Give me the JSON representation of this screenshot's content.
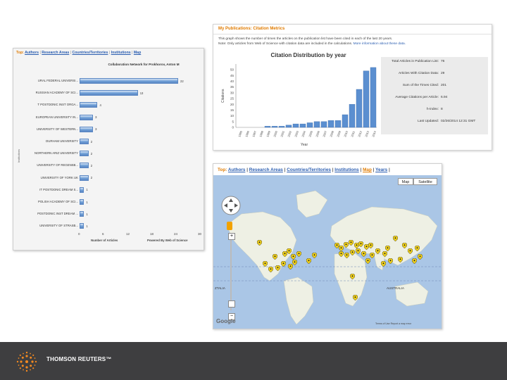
{
  "collab": {
    "nav": {
      "prefix": "Top:",
      "items": [
        "Authors",
        "Research Areas",
        "Countries/Territories",
        "Institutions",
        "Map"
      ]
    },
    "chart_title": "Collaboration Network for Prokhorov, Anton M",
    "y_axis_label": "Institutions",
    "x_label": "Number of Articles",
    "powered_by": "Powered By Web of Science",
    "chart_data": {
      "type": "bar",
      "orientation": "horizontal",
      "categories": [
        "URAL FEDERAL UNIVERSI...",
        "RUSSIAN ACADEMY OF SCI...",
        "T POSTDONIC INST ORGA...",
        "EUROPEAN UNIVERSITY IN...",
        "UNIVERSITY OF WESTERN...",
        "DURHAM UNIVERSITY",
        "NORTHERN ARIZ UNIVERSITY",
        "UNIVERSITY OF REGENSB...",
        "UNIVERSITY OF YORK UK",
        "IT POSTDONIC DREAM S...",
        "POLISH ACADEMY OF SCI...",
        "POSTDONIC INST DREAM ...",
        "UNIVERSITY OF STRASB..."
      ],
      "values": [
        22,
        13,
        4,
        3,
        3,
        2,
        2,
        2,
        2,
        1,
        1,
        1,
        1
      ],
      "value_labels": [
        "22",
        "13",
        "4",
        "3",
        "3",
        "2",
        "2",
        "2",
        "2",
        "1",
        "1",
        "1",
        "1"
      ],
      "xlim": [
        0,
        20
      ],
      "xticks": [
        "0",
        "6",
        "12",
        "18",
        "24",
        "30"
      ],
      "xlabel": "Number of Articles",
      "ylabel": "Institutions"
    }
  },
  "citation": {
    "header": "My Publications: Citation Metrics",
    "note1": "This graph shows the number of times the articles on the publication list have been cited in each of the last 20 years.",
    "note2_a": "Note: Only articles from Web of Science with citation data are included in the calculations.",
    "note2_link": "More information about these data.",
    "chart_title": "Citation Distribution by year",
    "y_axis_label": "Citations",
    "x_axis_label": "Year",
    "chart_data": {
      "type": "bar",
      "title": "Citation Distribution by year",
      "xlabel": "Year",
      "ylabel": "Citations",
      "ylim": [
        0,
        55
      ],
      "yticks": [
        "0",
        "5",
        "10",
        "15",
        "20",
        "25",
        "30",
        "35",
        "40",
        "45",
        "50"
      ],
      "categories": [
        "1995",
        "1996",
        "1997",
        "1998",
        "1999",
        "2000",
        "2001",
        "2002",
        "2003",
        "2004",
        "2005",
        "2006",
        "2007",
        "2008",
        "2009",
        "2010",
        "2011",
        "2012",
        "2013",
        "2014"
      ],
      "values": [
        0,
        0,
        0,
        0,
        1,
        1,
        1,
        2,
        3,
        3,
        4,
        5,
        5,
        6,
        6,
        11,
        20,
        33,
        49,
        52
      ]
    },
    "stats": [
      {
        "label": "Total Articles in Publication List:",
        "value": "76"
      },
      {
        "label": "Articles With Citation Data:",
        "value": "29"
      },
      {
        "label": "Sum of the Times Cited:",
        "value": "201"
      },
      {
        "label": "Average Citations per Article:",
        "value": "6.94"
      },
      {
        "label": "h-index:",
        "value": "8"
      },
      {
        "label": "Last Updated:",
        "value": "02/26/2014 12:31 GMT"
      }
    ]
  },
  "map": {
    "nav": {
      "prefix": "Top:",
      "items": [
        "Authors",
        "Research Areas",
        "Countries/Territories",
        "Institutions"
      ],
      "current": "Map",
      "last": "Years"
    },
    "map_button": "Map",
    "satellite_button": "Satellite",
    "labels": [
      "AUSTRALIA",
      "ZTALIA"
    ],
    "google": "Google",
    "attribution": "Terms of Use   Report a map error",
    "colors": {
      "ocean": "#aac6e6",
      "land": "#eef0e4",
      "pin": "#f2d21b"
    }
  },
  "footer": {
    "brand": "THOMSON REUTERS™",
    "color": "#3e3e40"
  }
}
